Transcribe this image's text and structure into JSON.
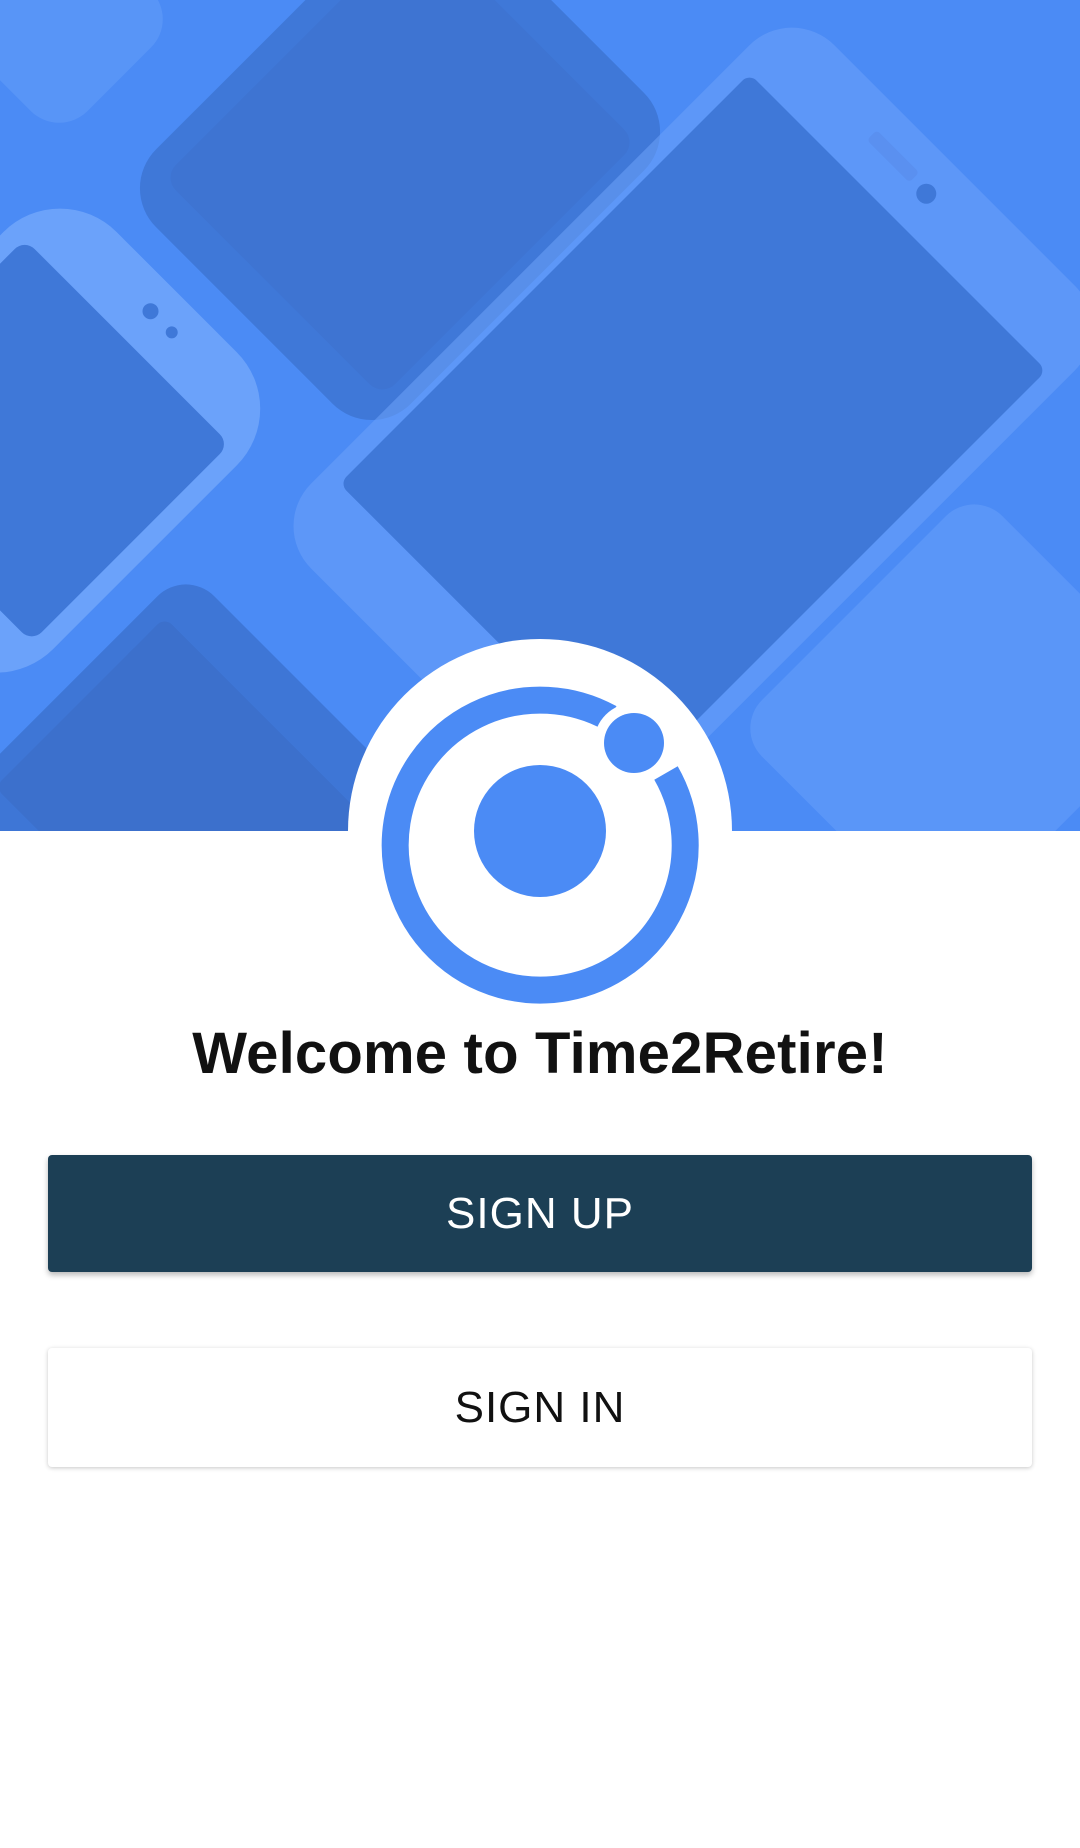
{
  "hero": {
    "background_color": "#4b8bf5",
    "shade_color": "#3f78d8",
    "device_light_color": "#6ea3fa"
  },
  "logo": {
    "icon": "ionic-logo-icon",
    "color": "#4b8bf5"
  },
  "welcome": {
    "title": "Welcome to Time2Retire!"
  },
  "actions": {
    "signup_label": "SIGN UP",
    "signin_label": "SIGN IN",
    "signup_color": "#1c3f55"
  }
}
